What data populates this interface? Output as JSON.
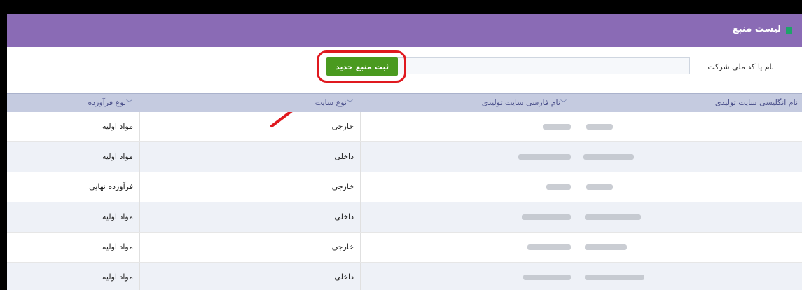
{
  "header": {
    "title": "لیست منبع"
  },
  "filter": {
    "label": "نام یا کد ملی شرکت",
    "value": "",
    "new_button_label": "ثبت منبع جدید"
  },
  "table": {
    "columns": [
      "نام انگلیسی سایت تولیدی",
      "نام فارسی سایت تولیدی",
      "نوع سایت",
      "نوع فرآورده"
    ],
    "rows": [
      {
        "site_type": "خارجی",
        "product_type": "مواد اولیه"
      },
      {
        "site_type": "داخلی",
        "product_type": "مواد اولیه"
      },
      {
        "site_type": "خارجی",
        "product_type": "فرآورده نهایی"
      },
      {
        "site_type": "داخلی",
        "product_type": "مواد اولیه"
      },
      {
        "site_type": "خارجی",
        "product_type": "مواد اولیه"
      },
      {
        "site_type": "داخلی",
        "product_type": "مواد اولیه"
      }
    ]
  },
  "colors": {
    "header": "#8a6bb5",
    "button": "#4a9a1f",
    "highlight": "#e0191f",
    "table_header": "#c5cbe0"
  }
}
